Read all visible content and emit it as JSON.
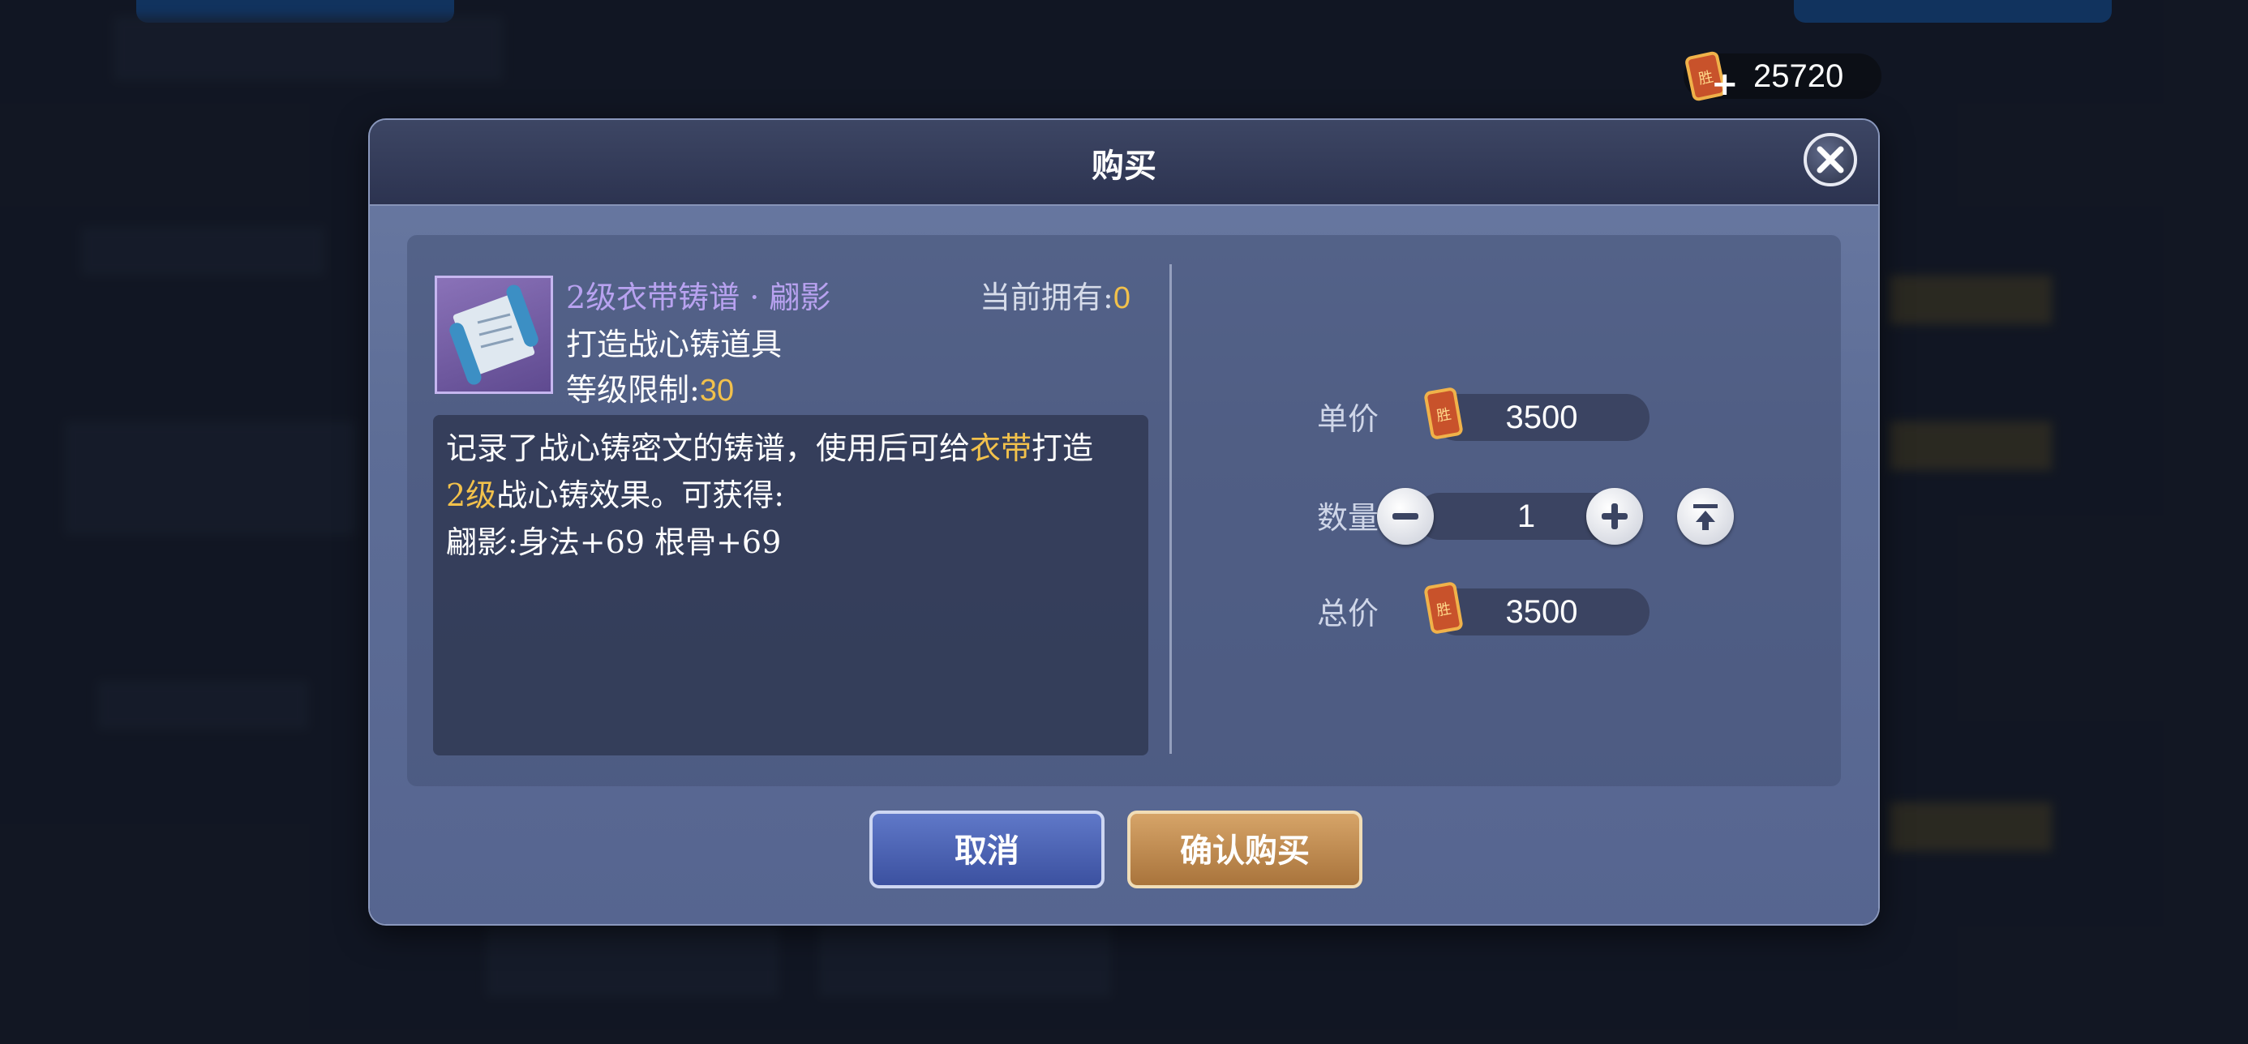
{
  "currency": {
    "icon": "token-icon",
    "plus": "+",
    "amount": "25720"
  },
  "dialog": {
    "title": "购买",
    "item": {
      "name": "2级衣带铸谱 · 翩影",
      "owned_label": "当前拥有:",
      "owned_value": "0",
      "type": "打造战心铸道具",
      "level_label": "等级限制:",
      "level_value": "30"
    },
    "description": {
      "line1_a": "记录了战心铸密文的铸谱，使用后可给",
      "line1_hl": "衣带",
      "line1_b": "打造",
      "line2_hl": "2级",
      "line2_b": "战心铸效果。可获得:",
      "line3": "翩影:身法+69  根骨+69"
    },
    "unit_price": {
      "label": "单价",
      "value": "3500"
    },
    "quantity": {
      "label": "数量",
      "value": "1"
    },
    "total_price": {
      "label": "总价",
      "value": "3500"
    },
    "buttons": {
      "cancel": "取消",
      "confirm": "确认购买"
    }
  },
  "colors": {
    "highlight": "#f2c14b",
    "item_name": "#b8a2f0",
    "cancel": "#4a62b4",
    "confirm": "#c08a50"
  }
}
